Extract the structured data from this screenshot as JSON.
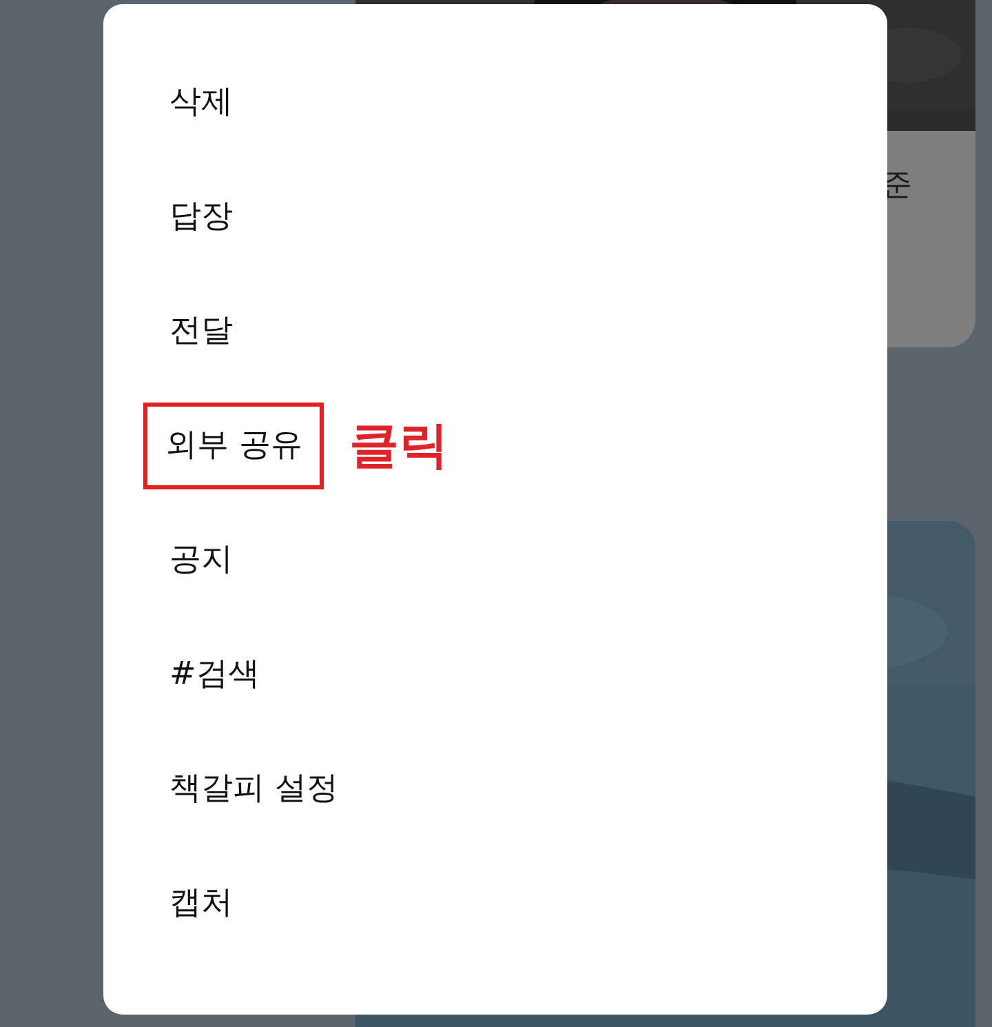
{
  "background": {
    "message_text": "준"
  },
  "menu": {
    "items": [
      {
        "label": "삭제",
        "highlighted": false
      },
      {
        "label": "답장",
        "highlighted": false
      },
      {
        "label": "전달",
        "highlighted": false
      },
      {
        "label": "외부 공유",
        "highlighted": true
      },
      {
        "label": "공지",
        "highlighted": false
      },
      {
        "label": "#검색",
        "highlighted": false
      },
      {
        "label": "책갈피 설정",
        "highlighted": false
      },
      {
        "label": "캡처",
        "highlighted": false
      }
    ]
  },
  "annotation": {
    "label": "클릭"
  }
}
